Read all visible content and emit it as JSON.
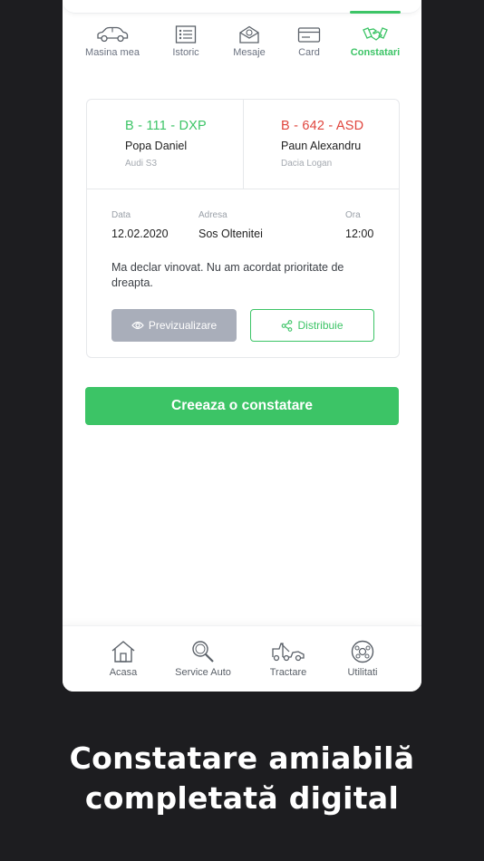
{
  "tabs": [
    {
      "label": "Masina mea",
      "icon": "car-icon",
      "active": false
    },
    {
      "label": "Istoric",
      "icon": "history-list-icon",
      "active": false
    },
    {
      "label": "Mesaje",
      "icon": "envelope-icon",
      "active": false
    },
    {
      "label": "Card",
      "icon": "credit-card-icon",
      "active": false
    },
    {
      "label": "Constatari",
      "icon": "handshake-icon",
      "active": true
    }
  ],
  "report": {
    "vehicle_a": {
      "plate": "B - 111 - DXP",
      "driver": "Popa Daniel",
      "car": "Audi S3"
    },
    "vehicle_b": {
      "plate": "B - 642 - ASD",
      "driver": "Paun Alexandru",
      "car": "Dacia Logan"
    },
    "date_label": "Data",
    "date": "12.02.2020",
    "address_label": "Adresa",
    "address": "Sos Oltenitei",
    "time_label": "Ora",
    "time": "12:00",
    "description": "Ma declar vinovat. Nu am acordat prioritate de dreapta.",
    "preview_label": "Previzualizare",
    "share_label": "Distribuie"
  },
  "create_button": "Creeaza o constatare",
  "bottom_nav": [
    {
      "label": "Acasa",
      "icon": "home-icon"
    },
    {
      "label": "Service Auto",
      "icon": "search-icon"
    },
    {
      "label": "Tractare",
      "icon": "tow-truck-icon"
    },
    {
      "label": "Utilitati",
      "icon": "utilities-icon"
    }
  ],
  "headline": {
    "line1": "Constatare amiabilă",
    "line2": "completată digital"
  },
  "colors": {
    "accent": "#3cc466",
    "danger": "#e0453d",
    "background": "#1d1d20",
    "disabled": "#a9aeba"
  }
}
